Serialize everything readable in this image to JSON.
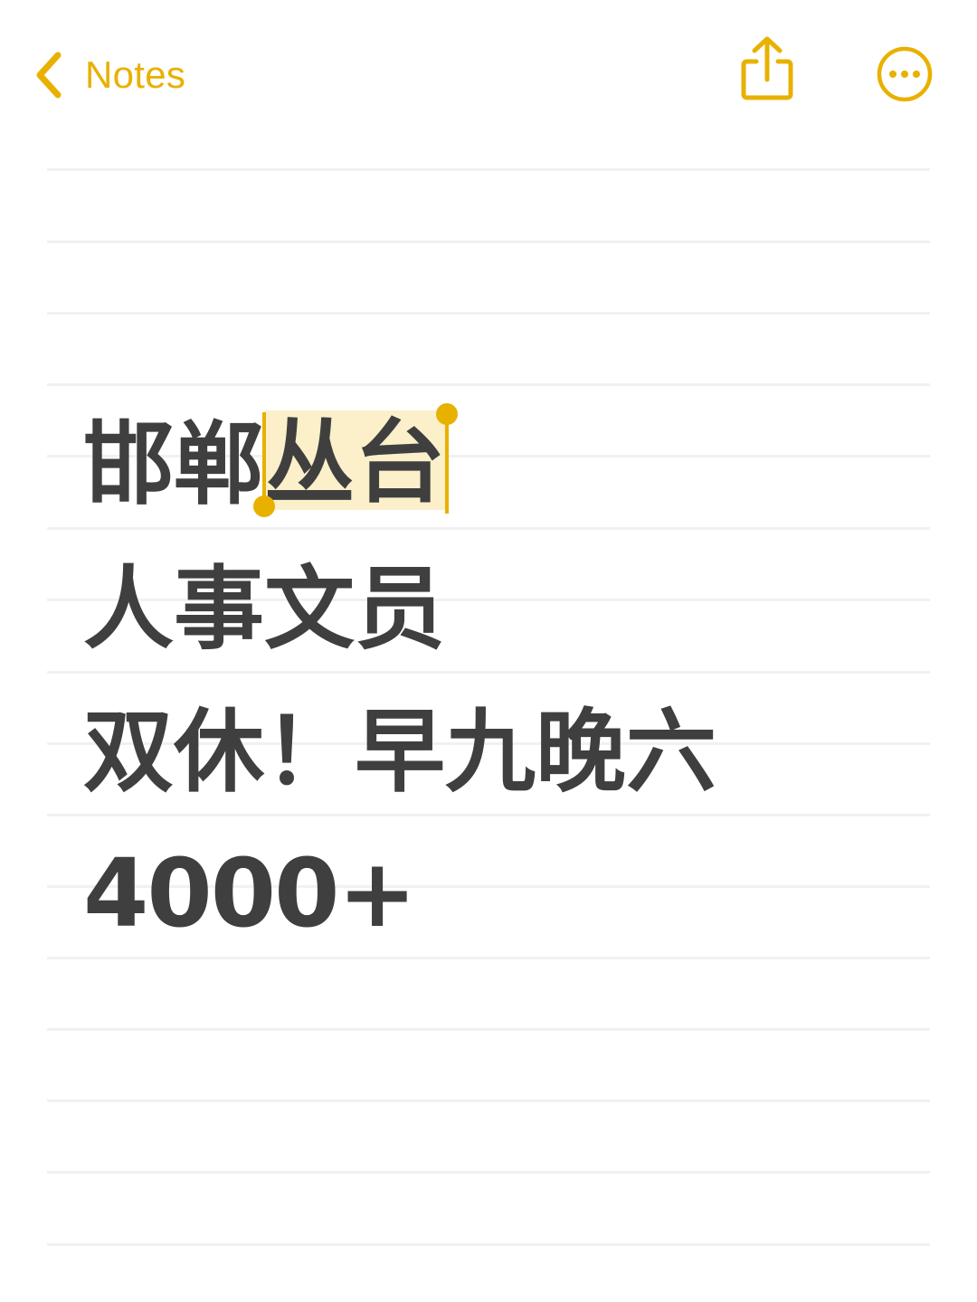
{
  "app": {
    "accent_color": "#E8B100",
    "text_color": "#3f3f3f",
    "rule_color": "#f1f1f1"
  },
  "navbar": {
    "back_label": "Notes",
    "back_icon": "chevron-left-icon",
    "share_icon": "share-icon",
    "more_icon": "ellipsis-circle-icon"
  },
  "note": {
    "line1_plain": "邯郸",
    "line1_selected": "丛台",
    "line2": "人事文员",
    "line3": "双休！早九晚六",
    "line4": "4000+"
  }
}
